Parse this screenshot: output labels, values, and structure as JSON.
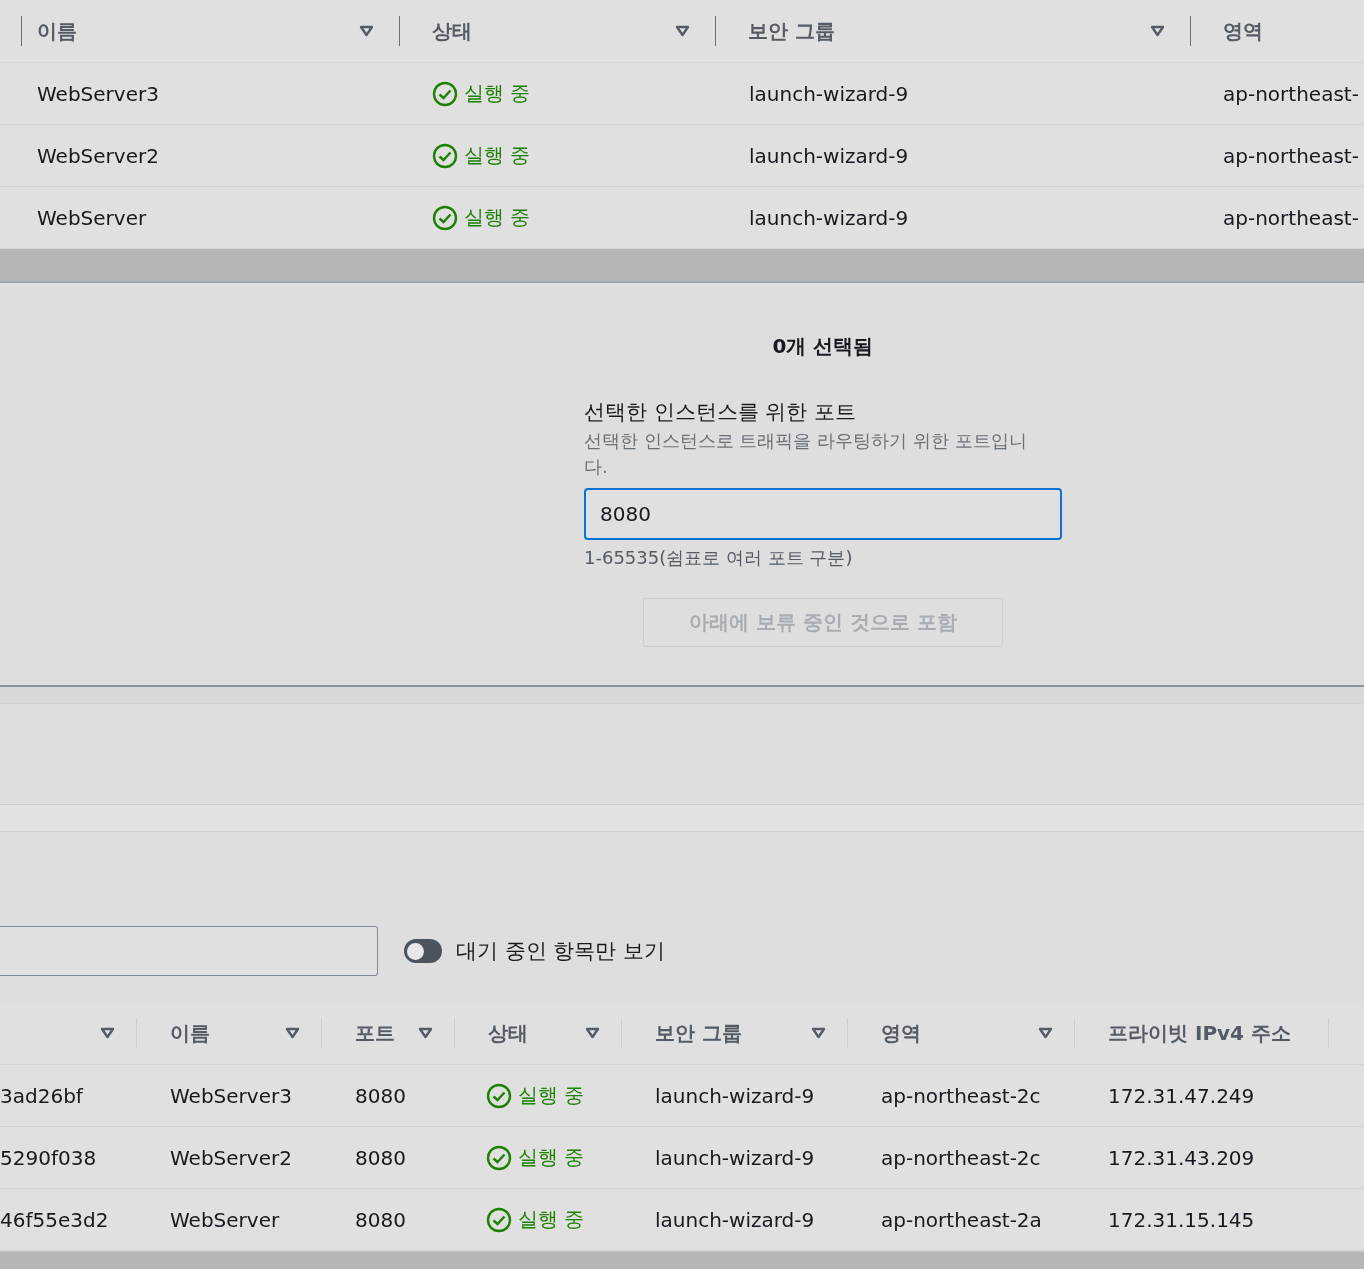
{
  "top_table": {
    "columns": [
      "이름",
      "상태",
      "보안 그룹",
      "영역"
    ],
    "rows": [
      {
        "name": "WebServer3",
        "status": "실행 중",
        "security_group": "launch-wizard-9",
        "region": "ap-northeast-"
      },
      {
        "name": "WebServer2",
        "status": "실행 중",
        "security_group": "launch-wizard-9",
        "region": "ap-northeast-"
      },
      {
        "name": "WebServer",
        "status": "실행 중",
        "security_group": "launch-wizard-9",
        "region": "ap-northeast-"
      }
    ]
  },
  "port_panel": {
    "title": "0개 선택됨",
    "label": "선택한 인스턴스를 위한 포트",
    "description": "선택한 인스턴스로 트래픽을 라우팅하기 위한 포트입니다.",
    "value": "8080",
    "constraint": "1-65535(쉼표로 여러 포트 구분)",
    "button": {
      "label": "아래에 보류 중인 것으로 포함",
      "disabled": true
    }
  },
  "filter": {
    "toggle": {
      "label": "대기 중인 항목만 보기",
      "on": false
    }
  },
  "bottom_table": {
    "columns": [
      "이름",
      "포트",
      "상태",
      "보안 그룹",
      "영역",
      "프라이빗 IPv4 주소"
    ],
    "rows": [
      {
        "id": "3ad26bf",
        "name": "WebServer3",
        "port": "8080",
        "status": "실행 중",
        "security_group": "launch-wizard-9",
        "region": "ap-northeast-2c",
        "ip": "172.31.47.249"
      },
      {
        "id": "5290f038",
        "name": "WebServer2",
        "port": "8080",
        "status": "실행 중",
        "security_group": "launch-wizard-9",
        "region": "ap-northeast-2c",
        "ip": "172.31.43.209"
      },
      {
        "id": "46f55e3d2",
        "name": "WebServer",
        "port": "8080",
        "status": "실행 중",
        "security_group": "launch-wizard-9",
        "region": "ap-northeast-2a",
        "ip": "172.31.15.145"
      }
    ]
  }
}
